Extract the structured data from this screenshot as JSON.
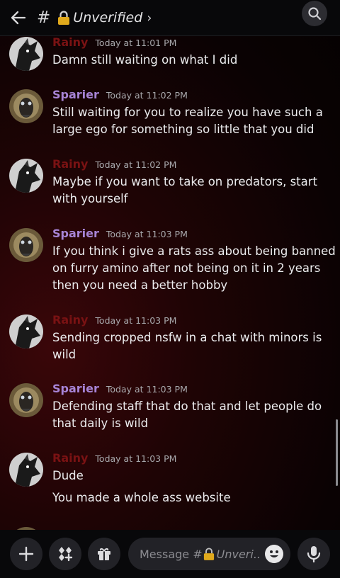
{
  "header": {
    "hash": "#",
    "channel": "Unverified",
    "chevron": "›",
    "back_icon": "arrow-left-icon",
    "search_icon": "search-icon"
  },
  "messages": [
    {
      "author": "Rainy",
      "time": "Today at 11:01 PM",
      "lines": [
        "Damn still waiting on what I did"
      ]
    },
    {
      "author": "Sparier",
      "time": "Today at 11:02 PM",
      "lines": [
        "Still waiting for you to realize you have such a",
        "large ego for something so little that you did"
      ]
    },
    {
      "author": "Rainy",
      "time": "Today at 11:02 PM",
      "lines": [
        "Maybe if you want to take on predators, start",
        "with yourself"
      ]
    },
    {
      "author": "Sparier",
      "time": "Today at 11:03 PM",
      "lines": [
        "If you think i give a rats ass about being banned",
        "on furry amino after not being on it in 2 years",
        "then you need a better hobby"
      ]
    },
    {
      "author": "Rainy",
      "time": "Today at 11:03 PM",
      "lines": [
        "Sending cropped nsfw in a chat with minors is",
        "wild"
      ]
    },
    {
      "author": "Sparier",
      "time": "Today at 11:03 PM",
      "lines": [
        "Defending staff that do that and let people do",
        "that daily is wild"
      ]
    },
    {
      "author": "Rainy",
      "time": "Today at 11:03 PM",
      "lines": [
        "Dude",
        "You made a whole ass website"
      ]
    }
  ],
  "composer": {
    "placeholder_prefix": "Message #",
    "placeholder_channel": "Unveri..",
    "icons": [
      "plus-icon",
      "apps-icon",
      "gift-icon",
      "emoji-icon",
      "microphone-icon"
    ]
  },
  "colors": {
    "rainy": "#7a1213",
    "sparier": "#a784d6",
    "header_bg": "#08080a",
    "button_bg": "#222227"
  }
}
